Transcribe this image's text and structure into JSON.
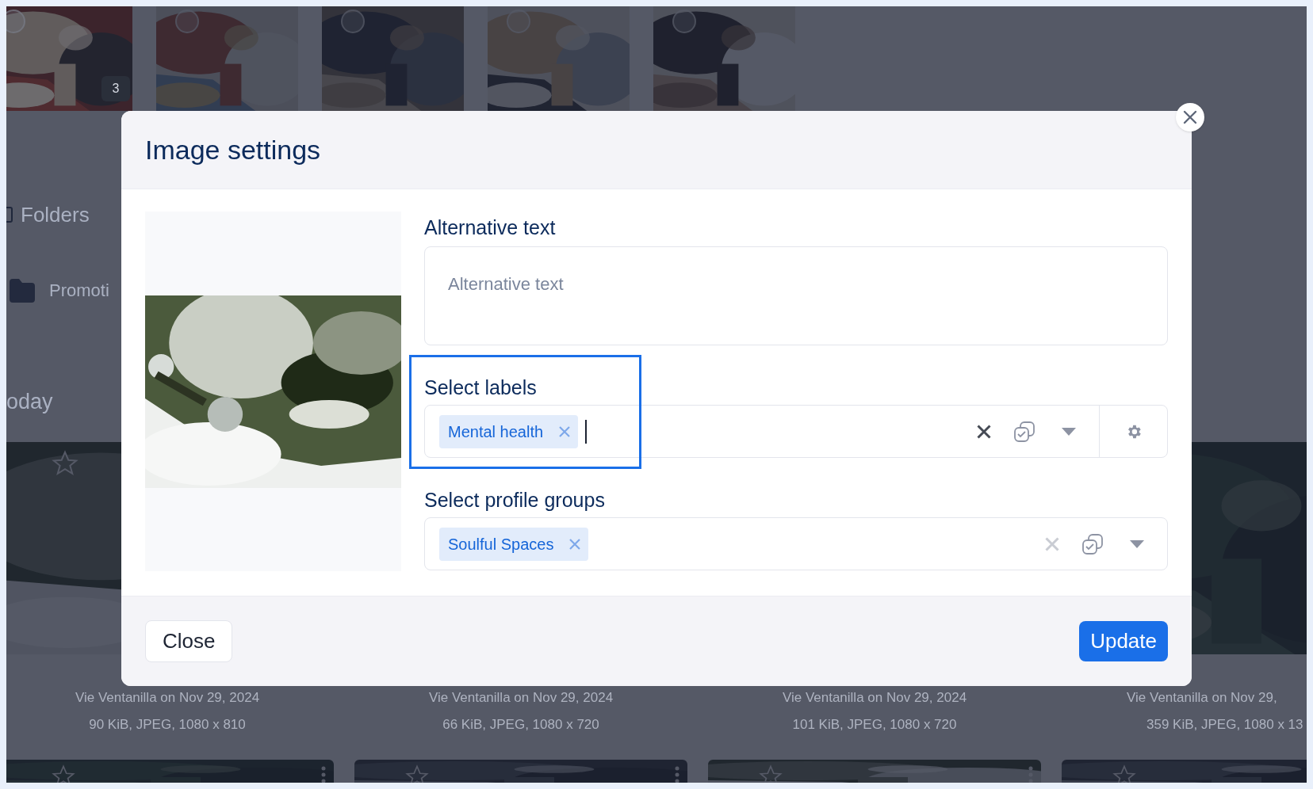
{
  "background": {
    "thumbnails": [
      {
        "kind": "picture",
        "badge": "3"
      },
      {
        "kind": "picture"
      },
      {
        "kind": "picture"
      },
      {
        "kind": "picture"
      },
      {
        "kind": "picture"
      }
    ],
    "sidebar": {
      "heading": "Folders",
      "folders": [
        {
          "name": "Promoti"
        }
      ]
    },
    "section_title": "oday",
    "grid": [
      {
        "image": {
          "kind": "picture"
        },
        "author": "Vie Ventanilla on Nov 29, 2024",
        "meta": "90 KiB, JPEG, 1080 x 810"
      },
      {
        "author": "Vie Ventanilla on Nov 29, 2024",
        "meta": "66 KiB, JPEG, 1080 x 720"
      },
      {
        "author": "Vie Ventanilla on Nov 29, 2024",
        "meta": "101 KiB, JPEG, 1080 x 720"
      },
      {
        "image": {
          "kind": "picture"
        },
        "author": "Vie Ventanilla on Nov 29,",
        "meta": "359 KiB, JPEG, 1080 x 13"
      }
    ],
    "bottom_row": [
      {
        "kind": "picture"
      },
      {
        "kind": "picture"
      },
      {
        "kind": "picture"
      },
      {
        "kind": "picture"
      }
    ]
  },
  "dialog": {
    "title": "Image settings",
    "preview": {
      "kind": "picture"
    },
    "alt_text": {
      "label": "Alternative text",
      "placeholder": "Alternative text"
    },
    "selects": [
      {
        "label": "Select labels",
        "tags": [
          {
            "text": "Mental health"
          }
        ],
        "focused": true,
        "highlighted": true,
        "settings": true
      },
      {
        "label": "Select profile groups",
        "tags": [
          {
            "text": "Soulful Spaces"
          }
        ],
        "focused": false,
        "highlighted": false,
        "settings": false
      }
    ],
    "buttons": {
      "close": "Close",
      "submit": "Update"
    }
  }
}
